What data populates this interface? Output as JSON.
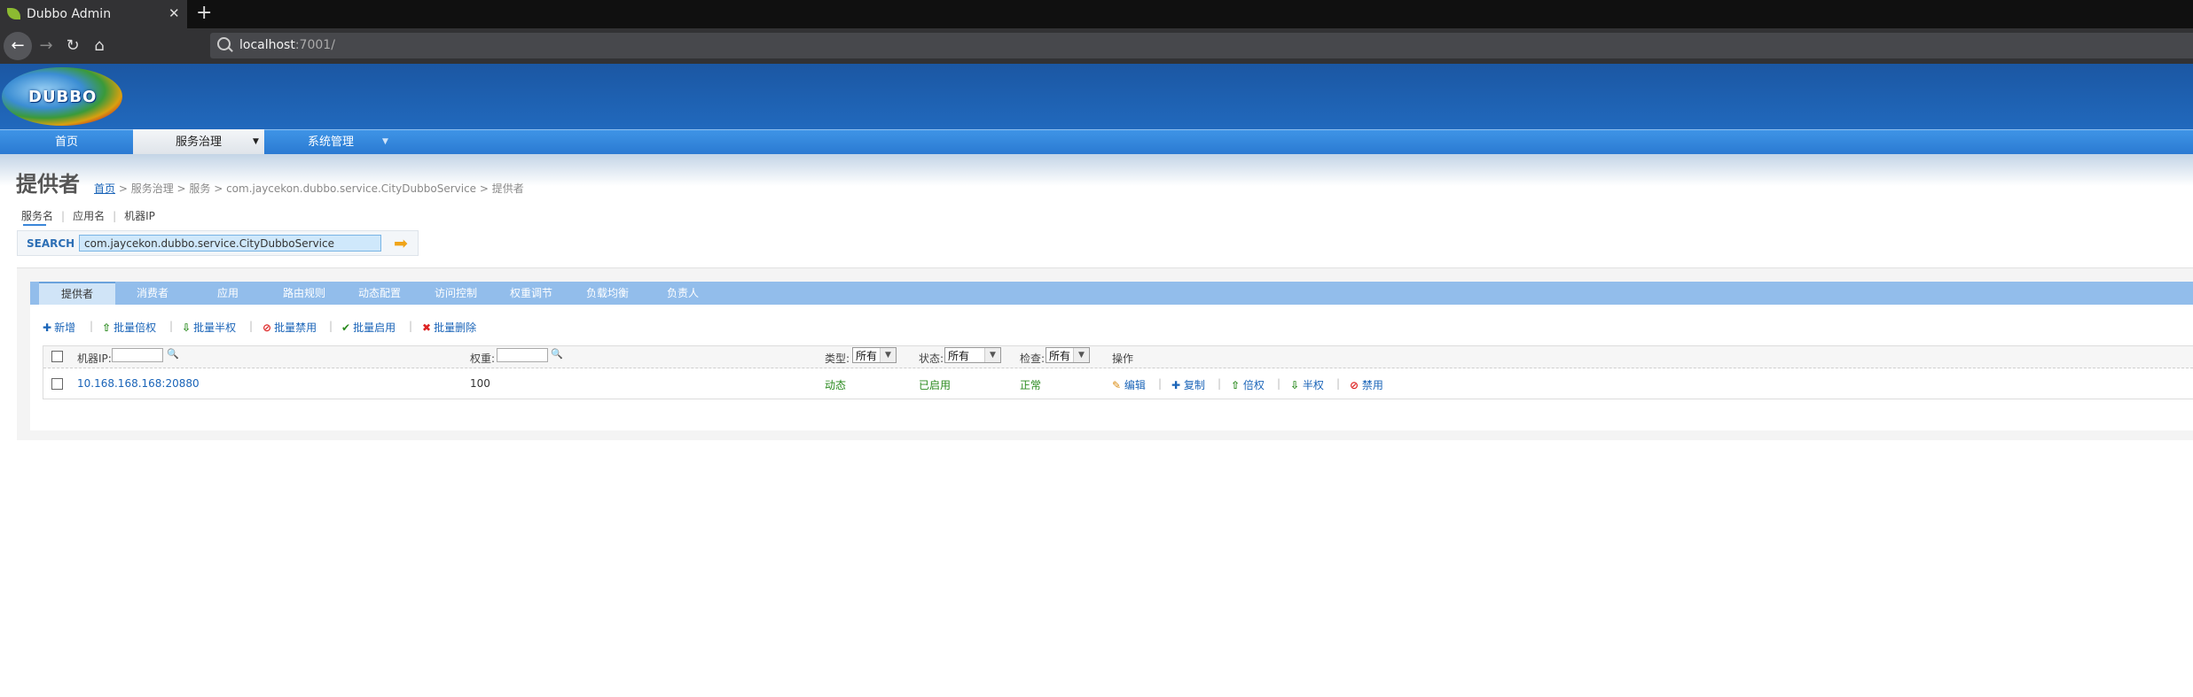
{
  "browser": {
    "tab_title": "Dubbo Admin",
    "url_host": "localhost",
    "url_port": ":7001/"
  },
  "app": {
    "logo_text": "DUBBO",
    "nav": [
      "首页",
      "服务治理",
      "系统管理"
    ]
  },
  "page": {
    "title": "提供者",
    "breadcrumb": {
      "home": "首页",
      "rest": " > 服务治理 > 服务 > com.jaycekon.dubbo.service.CityDubboService > 提供者"
    }
  },
  "search": {
    "tabs": [
      "服务名",
      "应用名",
      "机器IP"
    ],
    "label": "SEARCH",
    "value": "com.jaycekon.dubbo.service.CityDubboService"
  },
  "subtabs": [
    "提供者",
    "消费者",
    "应用",
    "路由规则",
    "动态配置",
    "访问控制",
    "权重调节",
    "负载均衡",
    "负责人"
  ],
  "actions": [
    {
      "icon": "✚",
      "label": "新增"
    },
    {
      "icon": "⇧",
      "label": "批量倍权"
    },
    {
      "icon": "⇩",
      "label": "批量半权"
    },
    {
      "icon": "⊘",
      "label": "批量禁用"
    },
    {
      "icon": "✔",
      "label": "批量启用"
    },
    {
      "icon": "✖",
      "label": "批量删除"
    }
  ],
  "table": {
    "headers": {
      "ip": "机器IP:",
      "weight": "权重:",
      "type": "类型:",
      "type_value": "所有",
      "status": "状态:",
      "status_value": "所有",
      "check": "检查:",
      "check_value": "所有",
      "ops": "操作"
    },
    "rows": [
      {
        "ip": "10.168.168.168:20880",
        "weight": "100",
        "type": "动态",
        "status": "已启用",
        "check": "正常"
      }
    ],
    "row_ops": [
      "编辑",
      "复制",
      "倍权",
      "半权",
      "禁用"
    ]
  },
  "colors": {
    "header_blue": "#2169bd",
    "menu_blue": "#3a8de0",
    "subtab_blue": "#92bdeb",
    "link_blue": "#1a64b8",
    "ok_green": "#2a8a1e"
  }
}
